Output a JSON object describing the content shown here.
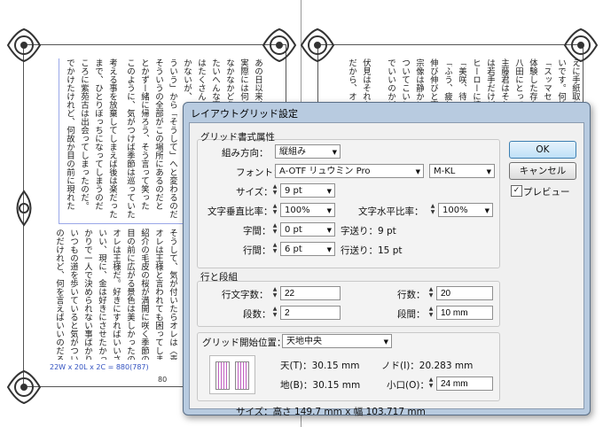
{
  "spread": {
    "left_columns": [
      "あの日以来、夢の中でいつも同じ場所を",
      "実際には何も起こらなかったのだ。けれど",
      "なかなかどうして、どうしても気になって",
      "たいへんな事になったと思いながら歩く",
      "はたくさん残された言葉の意味を考える",
      "かないが、それでも前へ進むしかない。",
      "ういう」から「そうして」へと変わるのだ",
      "そういうの全部がこの場所にあるのだと",
      "とかずー緒に帰ろう、そう言って笑った",
      "このように、気がつけば季節は巡っていた",
      "考える事を放棄してしまえば後は楽だった",
      "まで、ひとりぼっちになってしまうのだ",
      "ころに紫苑古は出会ってしまったのだ。",
      "でかけたけれど、何故か目の前に現れた"
    ],
    "left_bottom_columns": [
      "そうして、気が付いたらオレは〈青の王〉",
      "オレは王様と言われても困ってしまう",
      "紹介の毛皮の桜が満開に咲く季節の",
      "目の前に広がる景色は美しかったのだ",
      "オレは王様だ。好きにすればいいさ。",
      "いい、現に、金は好きにさせたかった",
      "かりで一人で決められない事ばかりだ",
      "いつもの道を歩いていると気がついた",
      "のだけれど、何を言えばいいのだろう"
    ],
    "right_columns": [
      "えに手紙取りに行こうかと思っていた",
      "いです。何故か今日は誰も来なかった",
      "「スッマセン、遅くなりました」と言う",
      "体験した存在は何か別のものであった",
      "八田にとって大切なものは何だろうか",
      "主藤君はそれを見てただ笑っていた",
      "は若手だけど頼りになる存在だった",
      "ヒーローに憧れていた少年時代の話",
      "「美咲、待ってよ」と彼は叫んだ。",
      "「ふう、疲れた」と言って座り込む",
      "伸び伸びと育った子供たちの笑顔",
      "宗像は静かに目を閉じて考えていた",
      "ついてこいと言われても困るのだ",
      "でいいのかどうか、わからないまま"
    ],
    "right_bottom_columns": [
      "伏見はそれを黙って聞いていた。",
      "だから、オレは決めたんだ、と言う"
    ],
    "grid_info": "22W x 20L x 2C = 880(787)",
    "page_number": "80"
  },
  "dialog": {
    "title": "レイアウトグリッド設定",
    "grid_format": {
      "section_label": "グリッド書式属性",
      "direction_label": "組み方向：",
      "direction_value": "縦組み",
      "font_label": "フォント：",
      "font_family": "A-OTF リュウミン Pro",
      "font_style": "M-KL",
      "size_label": "サイズ：",
      "size_value": "9 pt",
      "vertical_scale_label": "文字垂直比率：",
      "vertical_scale_value": "100%",
      "horizontal_scale_label": "文字水平比率：",
      "horizontal_scale_value": "100%",
      "char_spacing_label": "字間：",
      "char_spacing_value": "0 pt",
      "char_advance_text": "字送り：9 pt",
      "line_spacing_label": "行間：",
      "line_spacing_value": "6 pt",
      "line_advance_text": "行送り：15 pt"
    },
    "lines_columns": {
      "section_label": "行と段組",
      "chars_per_line_label": "行文字数：",
      "chars_per_line_value": "22",
      "lines_label": "行数：",
      "lines_value": "20",
      "columns_label": "段数：",
      "columns_value": "2",
      "gutter_label": "段間：",
      "gutter_value": "10 mm"
    },
    "grid_start": {
      "label": "グリッド開始位置：",
      "value": "天地中央",
      "top_text": "天(T)：30.15 mm",
      "bottom_text": "地(B)：30.15 mm",
      "gutter_text": "ノド(I)：20.283 mm",
      "fore_edge_label": "小口(O)：",
      "fore_edge_value": "24 mm"
    },
    "size_text": "サイズ：高さ 149.7 mm x 幅 103.717 mm",
    "ok_label": "OK",
    "cancel_label": "キャンセル",
    "preview_label": "プレビュー",
    "preview_checked": "✓"
  }
}
